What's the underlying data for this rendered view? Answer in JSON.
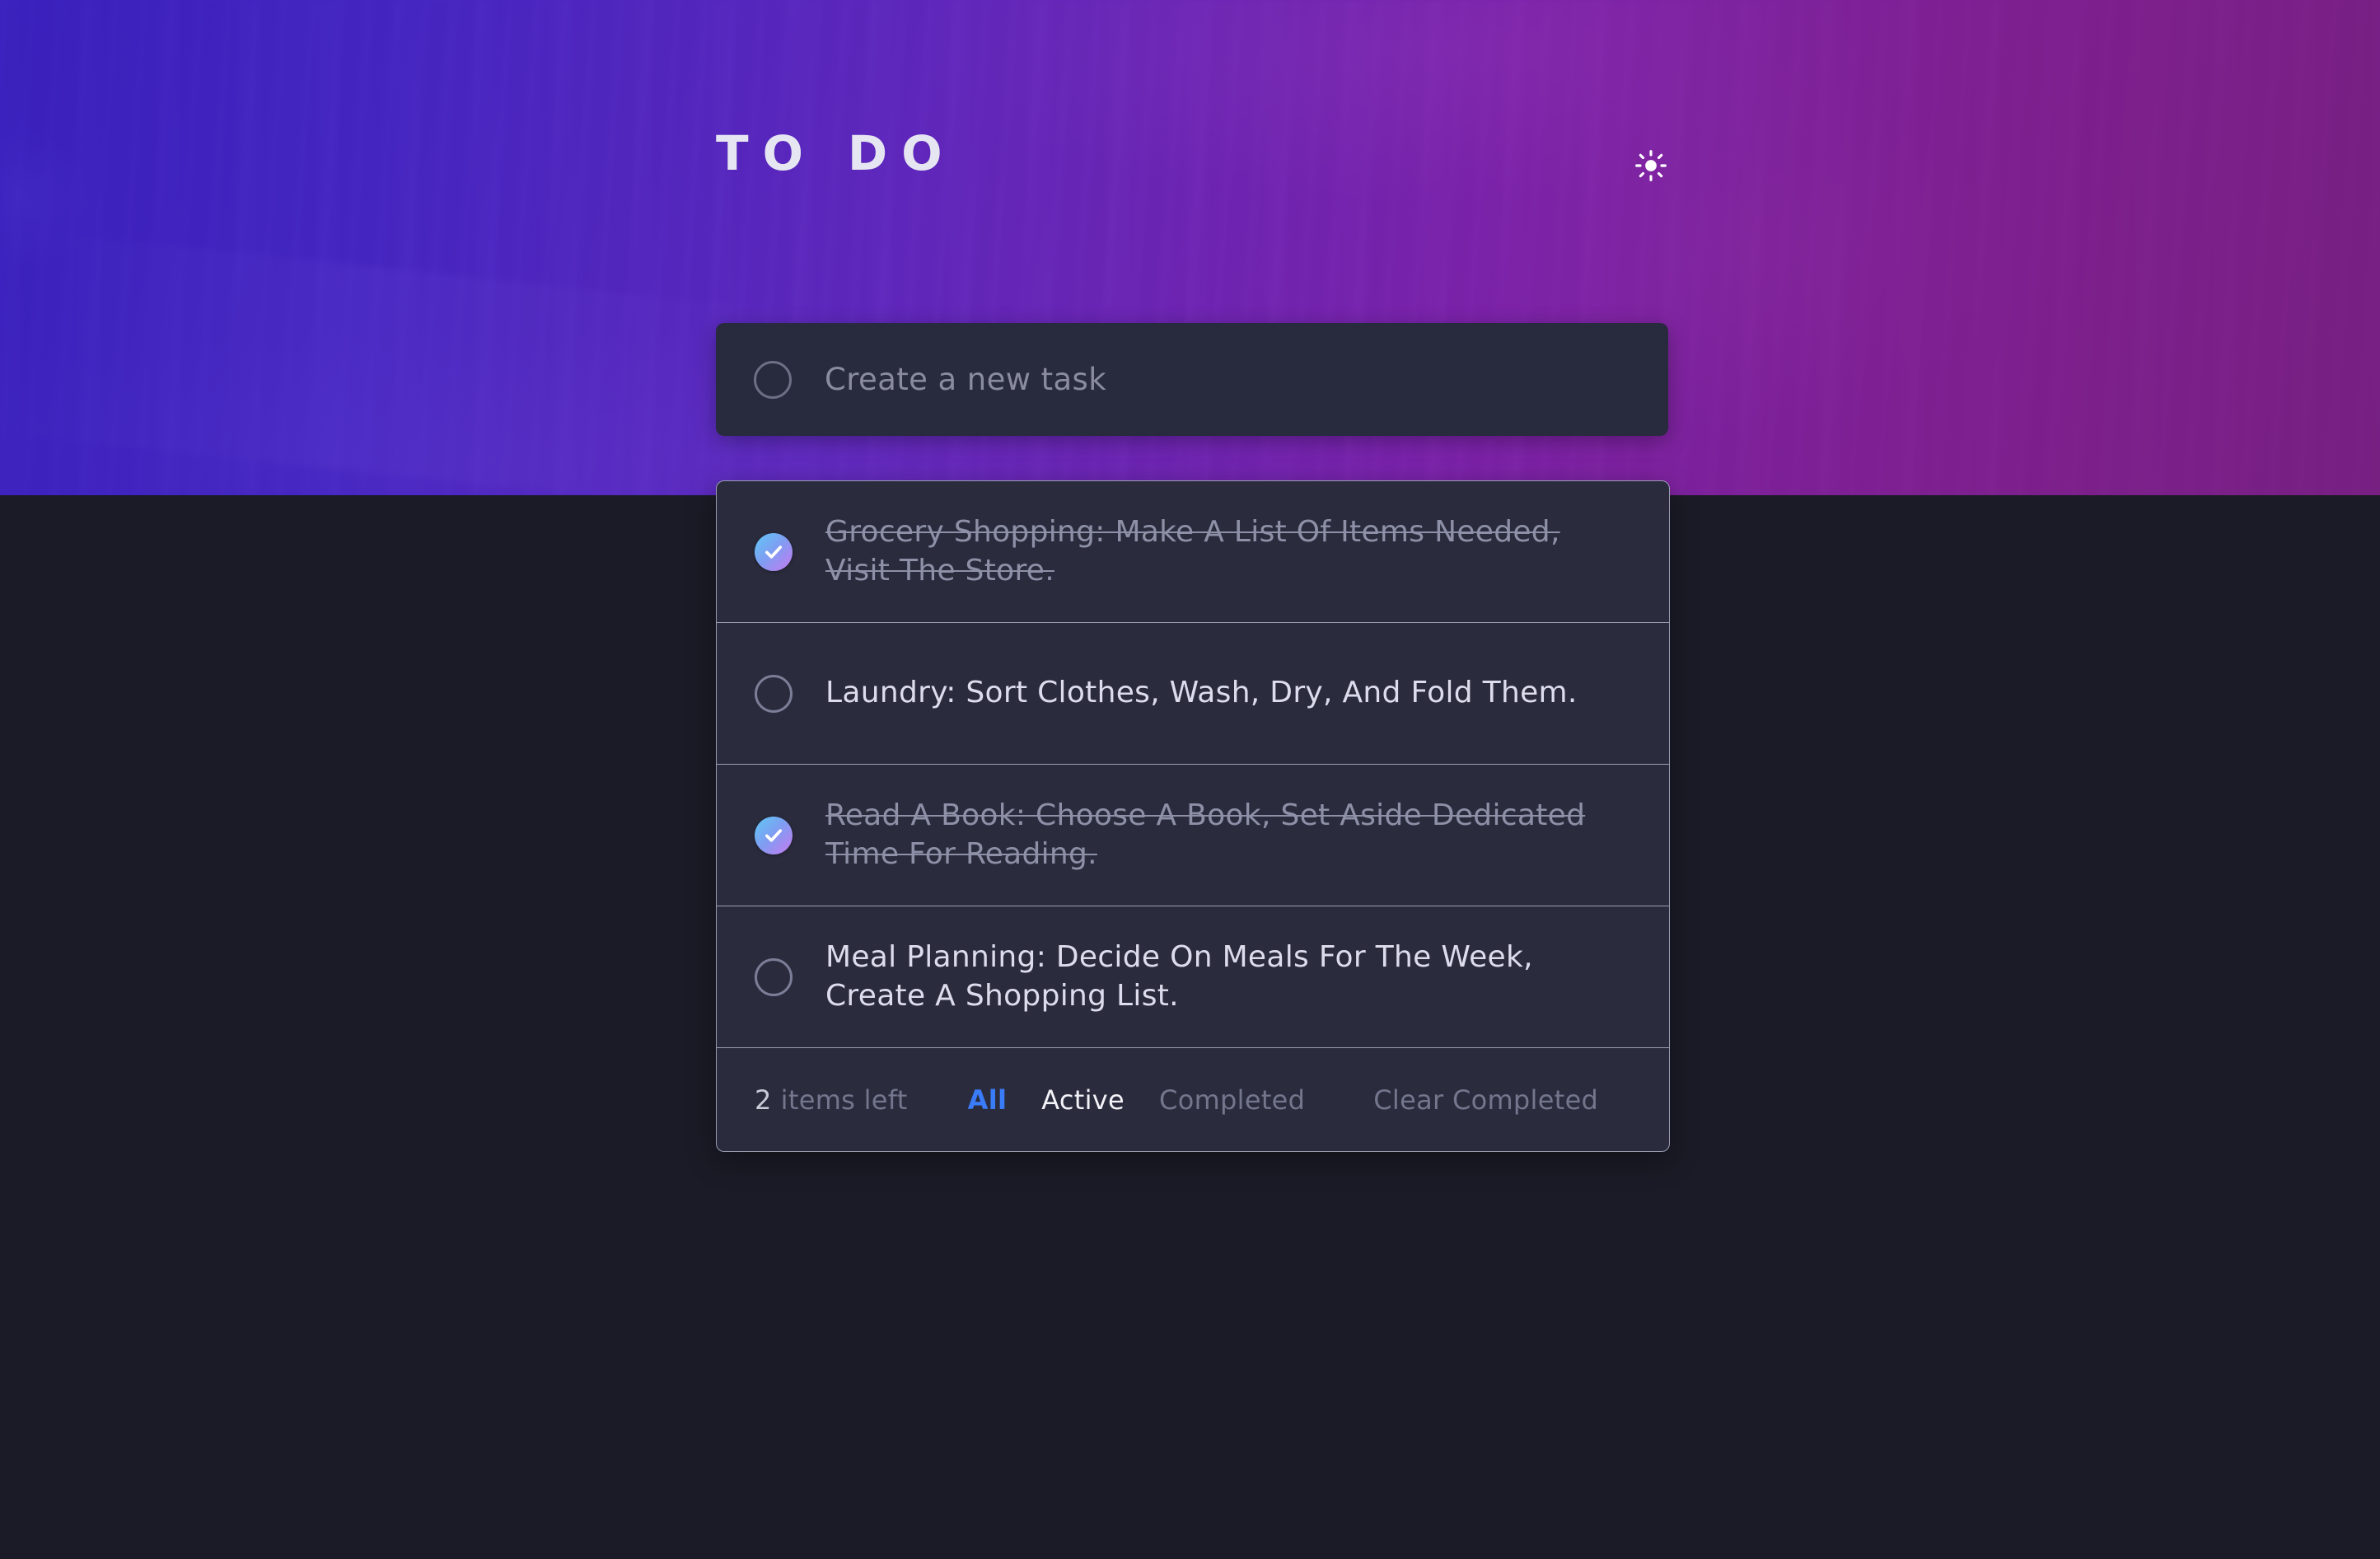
{
  "header": {
    "title": "TO DO",
    "theme_toggle_icon": "sun-icon",
    "gradient_from": "#3b23b8",
    "gradient_to": "#7c1f7e"
  },
  "new_task": {
    "placeholder": "Create a new task",
    "value": "",
    "circle_icon": "empty-circle-icon"
  },
  "tasks": [
    {
      "text": "Grocery Shopping: Make A List Of Items Needed, Visit The Store.",
      "completed": true,
      "icon": "check-circle-icon"
    },
    {
      "text": "Laundry: Sort Clothes, Wash, Dry, And Fold Them.",
      "completed": false,
      "icon": "empty-circle-icon"
    },
    {
      "text": "Read A Book: Choose A Book, Set Aside Dedicated Time For Reading.",
      "completed": true,
      "icon": "check-circle-icon"
    },
    {
      "text": "Meal Planning: Decide On Meals For The Week, Create A Shopping List.",
      "completed": false,
      "icon": "empty-circle-icon"
    }
  ],
  "footer": {
    "items_left_count": "2",
    "items_left_label": "items left",
    "filters": [
      {
        "label": "All",
        "state": "accent"
      },
      {
        "label": "Active",
        "state": "current"
      },
      {
        "label": "Completed",
        "state": "normal"
      }
    ],
    "clear_completed": "Clear Completed"
  },
  "colors": {
    "page_background": "#1a1b26",
    "card_background": "#2a2c3e",
    "input_background": "#282a3d",
    "accent_blue": "#3a7bf7",
    "check_gradient_start": "#5ec8f5",
    "check_gradient_end": "#c879f0",
    "muted_text": "#73768c",
    "bright_text": "#dcdcec"
  }
}
